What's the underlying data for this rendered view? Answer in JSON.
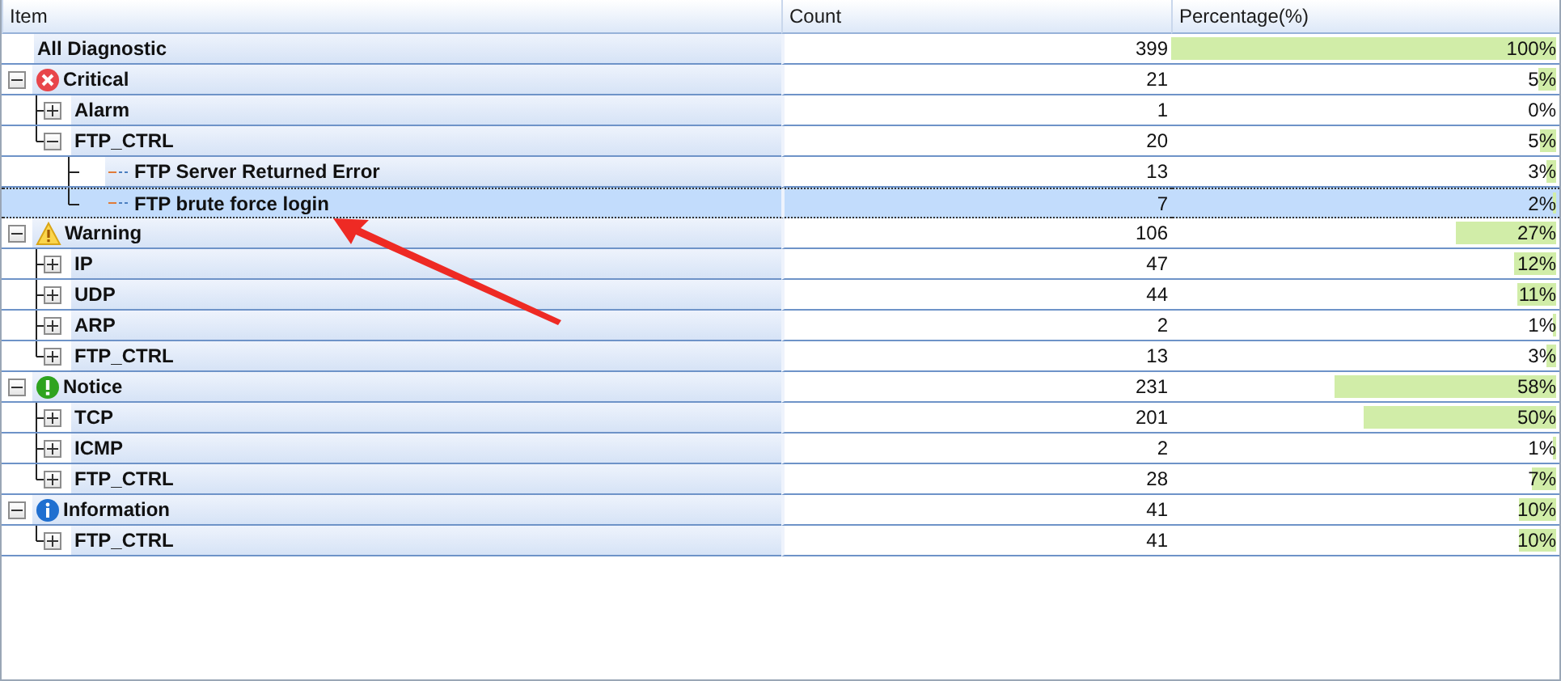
{
  "table": {
    "columns": [
      "Item",
      "Count",
      "Percentage(%)"
    ],
    "rows": [
      {
        "kind": "total",
        "label": "All Diagnostic",
        "count": "399",
        "percent": "100%",
        "level": 1,
        "selected": false
      },
      {
        "kind": "critical",
        "label": "Critical",
        "count": "21",
        "percent": "5%",
        "level": 0.053,
        "selected": false,
        "expanded": true,
        "children": [
          {
            "kind": "group",
            "label": "Alarm",
            "count": "1",
            "percent": "0%",
            "selected": false,
            "expanded": false
          },
          {
            "kind": "group",
            "label": "FTP_CTRL",
            "count": "20",
            "percent": "5%",
            "level": 0.05,
            "selected": false,
            "expanded": true,
            "children": [
              {
                "kind": "leaf",
                "label": "FTP Server Returned Error",
                "count": "13",
                "percent": "3%",
                "level": 0.033,
                "selected": false
              },
              {
                "kind": "leaf",
                "label": "FTP brute force login",
                "count": "7",
                "percent": "2%",
                "level": 0.018,
                "selected": true
              }
            ]
          }
        ]
      },
      {
        "kind": "warning",
        "label": "Warning",
        "count": "106",
        "percent": "27%",
        "level": 0.266,
        "selected": false,
        "expanded": true,
        "children": [
          {
            "kind": "group",
            "label": "IP",
            "count": "47",
            "percent": "12%",
            "level": 0.118,
            "selected": false,
            "expanded": false
          },
          {
            "kind": "group",
            "label": "UDP",
            "count": "44",
            "percent": "11%",
            "level": 0.11,
            "selected": false,
            "expanded": false
          },
          {
            "kind": "group",
            "label": "ARP",
            "count": "2",
            "percent": "1%",
            "level": 0.005,
            "selected": false,
            "expanded": false
          },
          {
            "kind": "group",
            "label": "FTP_CTRL",
            "count": "13",
            "percent": "3%",
            "level": 0.033,
            "selected": false,
            "expanded": false
          }
        ]
      },
      {
        "kind": "notice",
        "label": "Notice",
        "count": "231",
        "percent": "58%",
        "level": 0.579,
        "selected": false,
        "expanded": true,
        "children": [
          {
            "kind": "group",
            "label": "TCP",
            "count": "201",
            "percent": "50%",
            "level": 0.504,
            "selected": false,
            "expanded": false
          },
          {
            "kind": "group",
            "label": "ICMP",
            "count": "2",
            "percent": "1%",
            "level": 0.005,
            "selected": false,
            "expanded": false
          },
          {
            "kind": "group",
            "label": "FTP_CTRL",
            "count": "28",
            "percent": "7%",
            "level": 0.07,
            "selected": false,
            "expanded": false
          }
        ]
      },
      {
        "kind": "information",
        "label": "Information",
        "count": "41",
        "percent": "10%",
        "level": 0.103,
        "selected": false,
        "expanded": true,
        "children": [
          {
            "kind": "group",
            "label": "FTP_CTRL",
            "count": "41",
            "percent": "10%",
            "level": 0.103,
            "selected": false,
            "expanded": false
          }
        ]
      }
    ]
  }
}
